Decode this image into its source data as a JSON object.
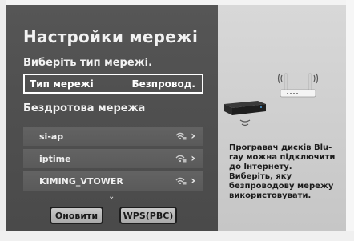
{
  "screen": {
    "title": "Настройки мережі",
    "subtitle": "Виберіть тип мережі.",
    "network_type": {
      "label": "Тип мережі",
      "value": "Безпровод."
    },
    "section_label": "Бездротова мережа",
    "networks": [
      {
        "name": "si-ap",
        "icon": "wifi-lock-icon"
      },
      {
        "name": "iptime",
        "icon": "wifi-lock-icon"
      },
      {
        "name": "KIMING_VTOWER",
        "icon": "wifi-lock-icon"
      }
    ],
    "buttons": {
      "refresh": "Оновити",
      "wps": "WPS(PBC)"
    },
    "description": "Програвач дисків Blu-ray можна підключити до Інтернету. Виберіть, яку безпроводову мережу використовувати."
  },
  "colors": {
    "panel_left": "#525252",
    "panel_right": "#d0d0d0",
    "text_light": "#f2f2f2",
    "text_dark": "#1b1b1b",
    "button": "#bcbcbc"
  }
}
